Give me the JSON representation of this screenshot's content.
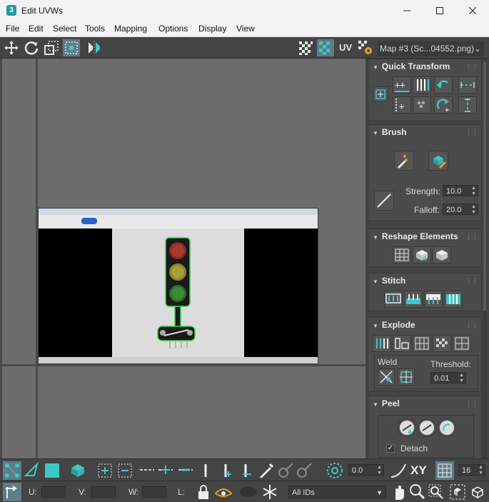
{
  "window": {
    "app_icon": "3",
    "title": "Edit UVWs"
  },
  "menu": [
    "File",
    "Edit",
    "Select",
    "Tools",
    "Mapping",
    "Options",
    "Display",
    "View"
  ],
  "toolbar": {
    "uv_label": "UV",
    "map_selector": "Map #3 (Sc...04552.png)"
  },
  "panel": {
    "quick_transform": "Quick Transform",
    "brush": "Brush",
    "strength_label": "Strength:",
    "strength_value": "10.0",
    "falloff_label": "Falloff:",
    "falloff_value": "20.0",
    "reshape": "Reshape Elements",
    "stitch": "Stitch",
    "explode": "Explode",
    "weld_label": "Weld",
    "threshold_label": "Threshold:",
    "threshold_value": "0.01",
    "peel": "Peel",
    "detach_label": "Detach",
    "detach_checked": true
  },
  "bottom1": {
    "angle_value": "0.0",
    "xy_label": "XY",
    "grid_value": "16"
  },
  "bottom2": {
    "u_label": "U:",
    "v_label": "V:",
    "w_label": "W:",
    "l_label": "L:",
    "ids_selector": "All IDs"
  },
  "colors": {
    "accent": "#3fc6c6",
    "panel_bg": "#444444",
    "viewport_bg": "#6c6c6c"
  }
}
